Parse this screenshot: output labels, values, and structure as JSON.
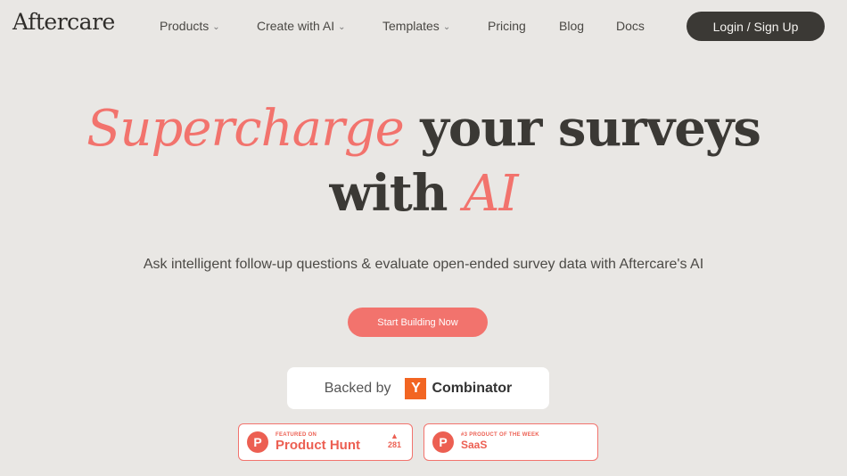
{
  "nav": {
    "logo": "Aftercare",
    "items": [
      {
        "label": "Products",
        "dropdown": true
      },
      {
        "label": "Create with AI",
        "dropdown": true
      },
      {
        "label": "Templates",
        "dropdown": true
      },
      {
        "label": "Pricing",
        "dropdown": false
      },
      {
        "label": "Blog",
        "dropdown": false
      },
      {
        "label": "Docs",
        "dropdown": false
      }
    ],
    "login_label": "Login / Sign Up",
    "chevron": "⌄"
  },
  "hero": {
    "title_accent_1": "Supercharge",
    "title_part_1": " your surveys",
    "title_part_2": "with ",
    "title_accent_2": "AI",
    "subtitle": "Ask intelligent follow-up questions & evaluate open-ended survey data with Aftercare's AI",
    "cta_label": "Start Building Now"
  },
  "backed": {
    "prefix": "Backed by",
    "logo_letter": "Y",
    "name": "Combinator"
  },
  "badges": [
    {
      "icon_letter": "P",
      "small": "FEATURED ON",
      "big": "Product Hunt",
      "votes": "281",
      "arrow": "▲"
    },
    {
      "icon_letter": "P",
      "small": "#3 PRODUCT OF THE WEEK",
      "big": "SaaS"
    }
  ],
  "colors": {
    "accent": "#f2736d",
    "dark": "#3b3935",
    "background": "#e9e7e4",
    "yc_orange": "#f26522"
  }
}
